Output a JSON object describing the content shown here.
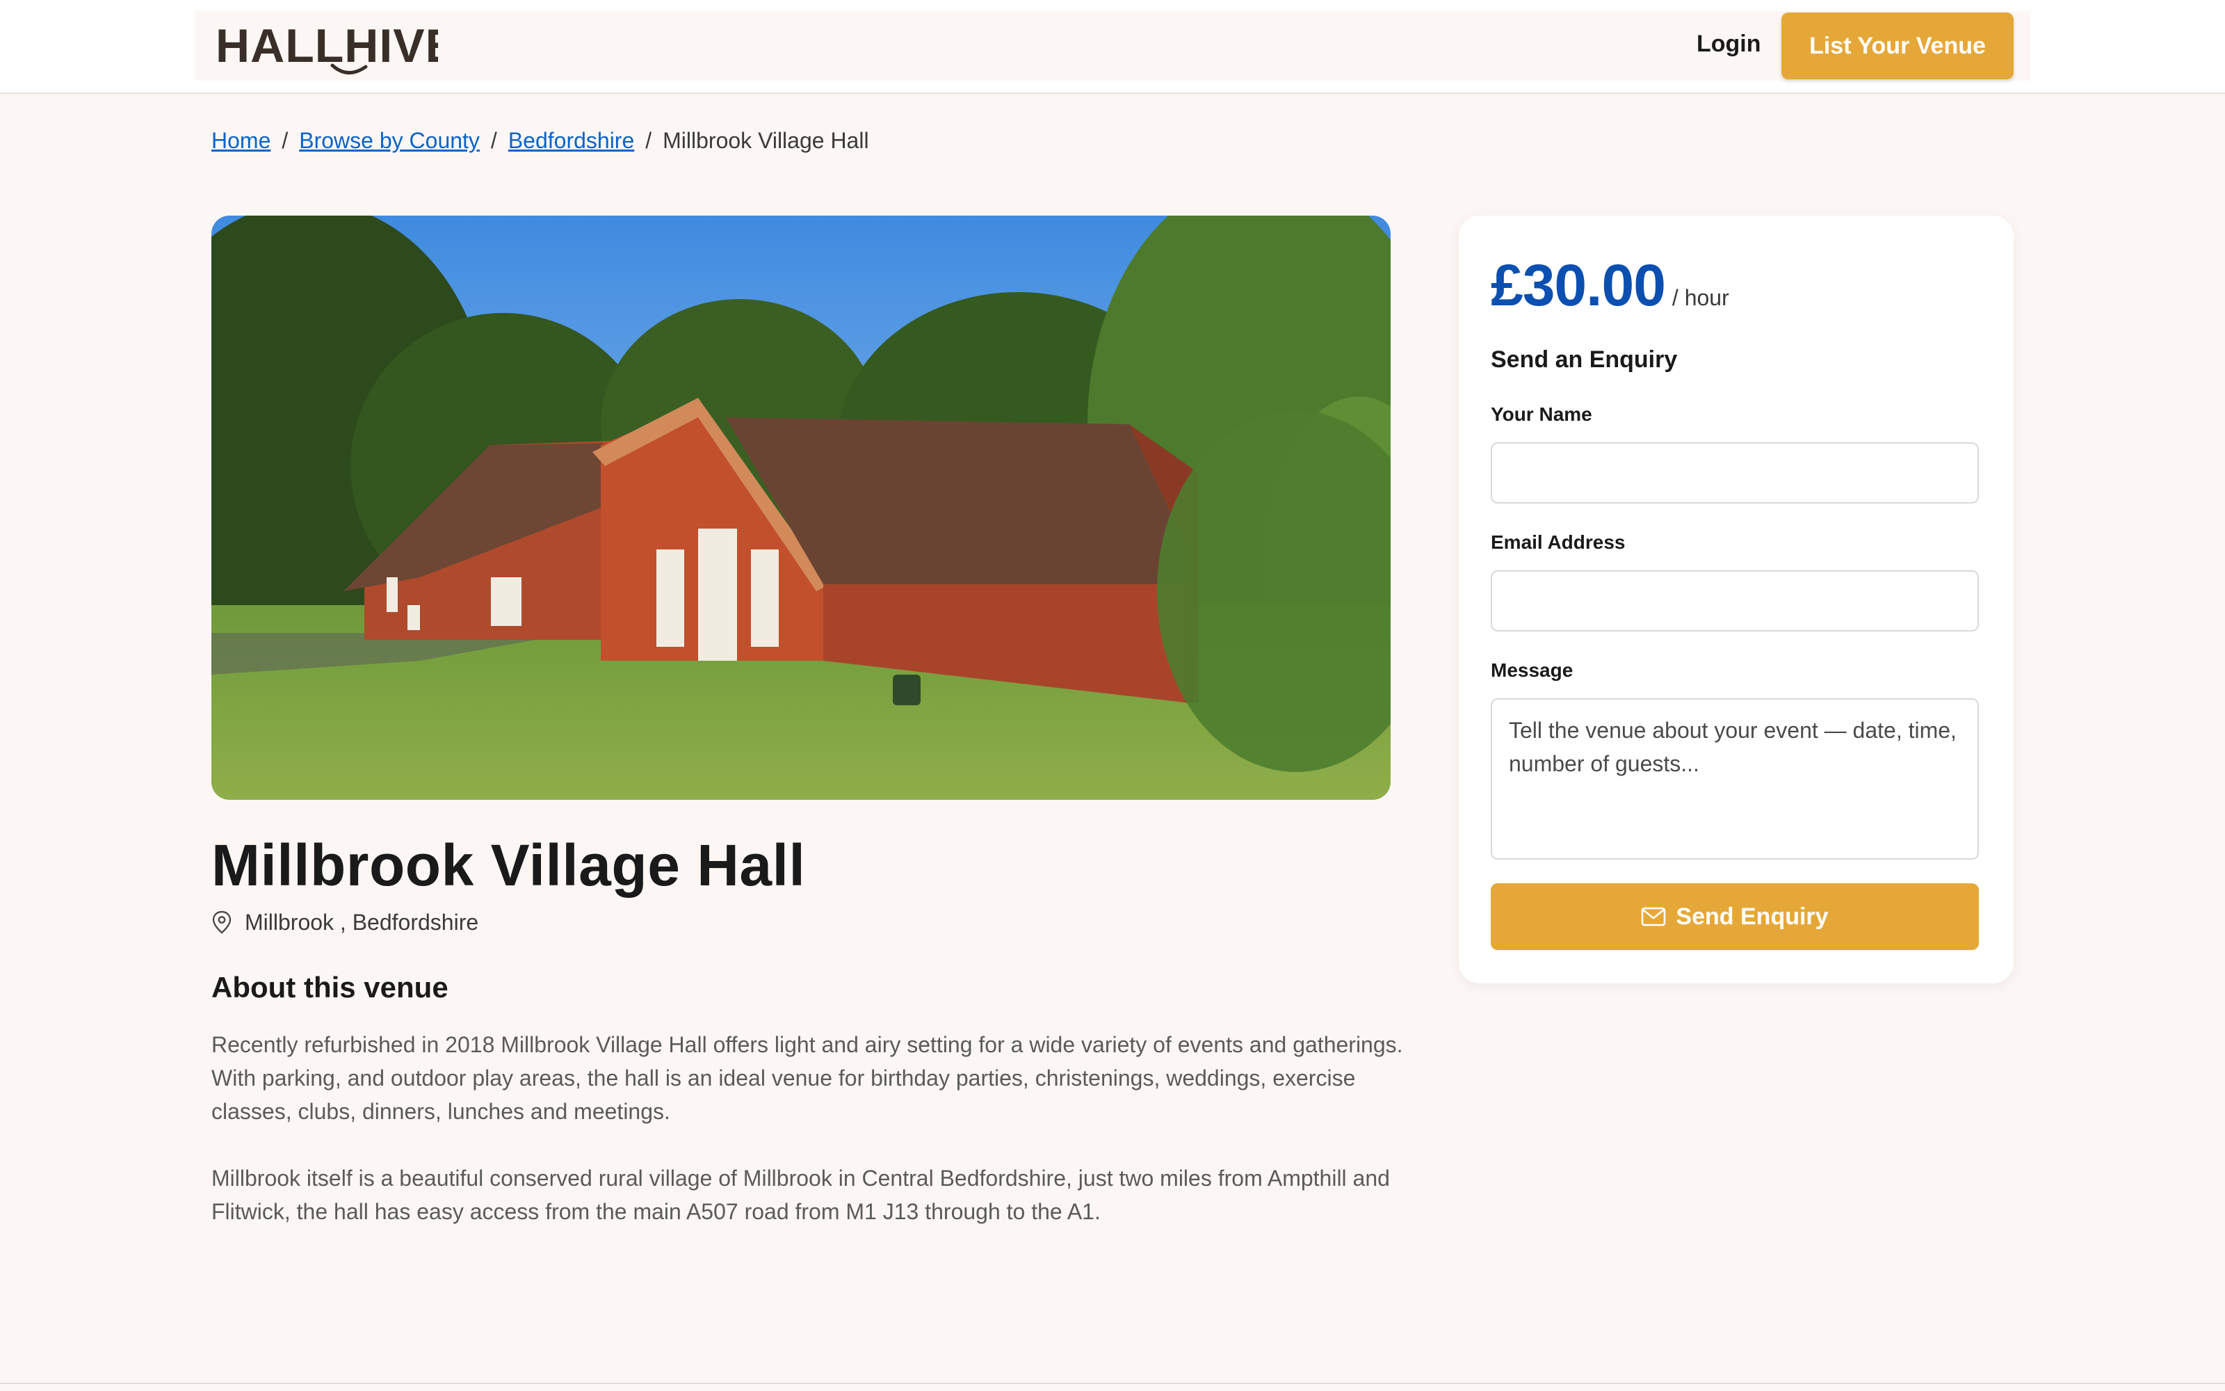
{
  "header": {
    "logo_text": "HALLHIVE",
    "login_label": "Login",
    "list_venue_label": "List Your Venue"
  },
  "breadcrumb": {
    "items": [
      "Home",
      "Browse by County",
      "Bedfordshire"
    ],
    "current": "Millbrook Village Hall",
    "separator": "/"
  },
  "venue": {
    "title": "Millbrook Village Hall",
    "location": "Millbrook , Bedfordshire",
    "about_heading": "About this venue",
    "description": [
      "Recently refurbished in 2018 Millbrook Village Hall offers light and airy setting for a wide variety of events and gatherings. With parking, and outdoor play areas, the hall is an ideal venue for birthday parties, christenings, weddings, exercise classes, clubs, dinners, lunches and meetings.",
      "Millbrook itself is a beautiful conserved rural village of Millbrook in Central Bedfordshire, just two miles from Ampthill and Flitwick, the hall has easy access from the main A507 road from M1 J13 through to the A1."
    ]
  },
  "pricing": {
    "price": "£30.00",
    "unit": "/ hour"
  },
  "enquiry": {
    "heading": "Send an Enquiry",
    "name_label": "Your Name",
    "name_value": "",
    "email_label": "Email Address",
    "email_value": "",
    "message_label": "Message",
    "message_placeholder": "Tell the venue about your event — date, time, number of guests...",
    "submit_label": "Send Enquiry"
  },
  "colors": {
    "accent": "#e5a838",
    "price": "#0b4fb0",
    "link": "#0b63c9",
    "background": "#fcf7f4"
  },
  "icons": {
    "location": "map-pin-icon",
    "send": "envelope-icon"
  }
}
